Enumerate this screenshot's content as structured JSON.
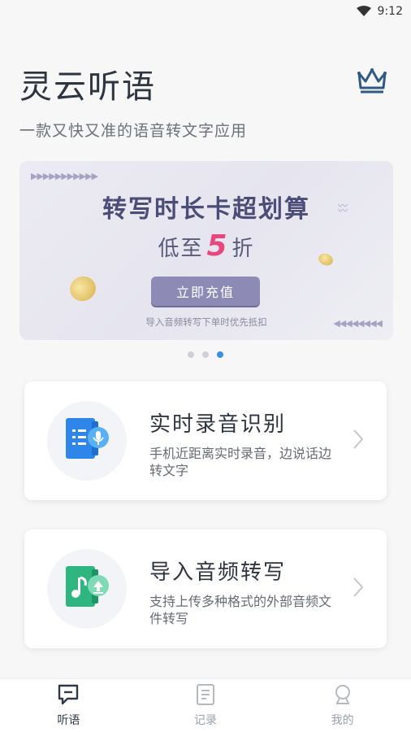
{
  "status_bar": {
    "time": "9:12"
  },
  "header": {
    "title": "灵云听语",
    "subtitle": "一款又快又准的语音转文字应用"
  },
  "banner": {
    "arrows_left": "▶▶▶▶▶▶▶▶▶▶▶",
    "arrows_right": "◀◀◀◀◀◀◀◀",
    "title": "转写时长卡超划算",
    "discount_prefix": "低至",
    "discount_number": "5",
    "discount_suffix": "折",
    "cta_label": "立即充值",
    "note": "导入音频转写下单时优先抵扣"
  },
  "carousel": {
    "count": 3,
    "active_index": 2
  },
  "cards": [
    {
      "title": "实时录音识别",
      "desc": "手机近距离实时录音，边说话边转文字",
      "icon": "microphone-book-icon"
    },
    {
      "title": "导入音频转写",
      "desc": "支持上传多种格式的外部音频文件转写",
      "icon": "music-upload-book-icon"
    }
  ],
  "tabs": [
    {
      "label": "听语",
      "icon": "chat-bubble-icon",
      "active": true
    },
    {
      "label": "记录",
      "icon": "document-icon",
      "active": false
    },
    {
      "label": "我的",
      "icon": "user-icon",
      "active": false
    }
  ],
  "colors": {
    "accent": "#3a8ee6",
    "discount": "#e9467c",
    "banner_title": "#4b4d78",
    "cta": "#8d8bb6"
  }
}
